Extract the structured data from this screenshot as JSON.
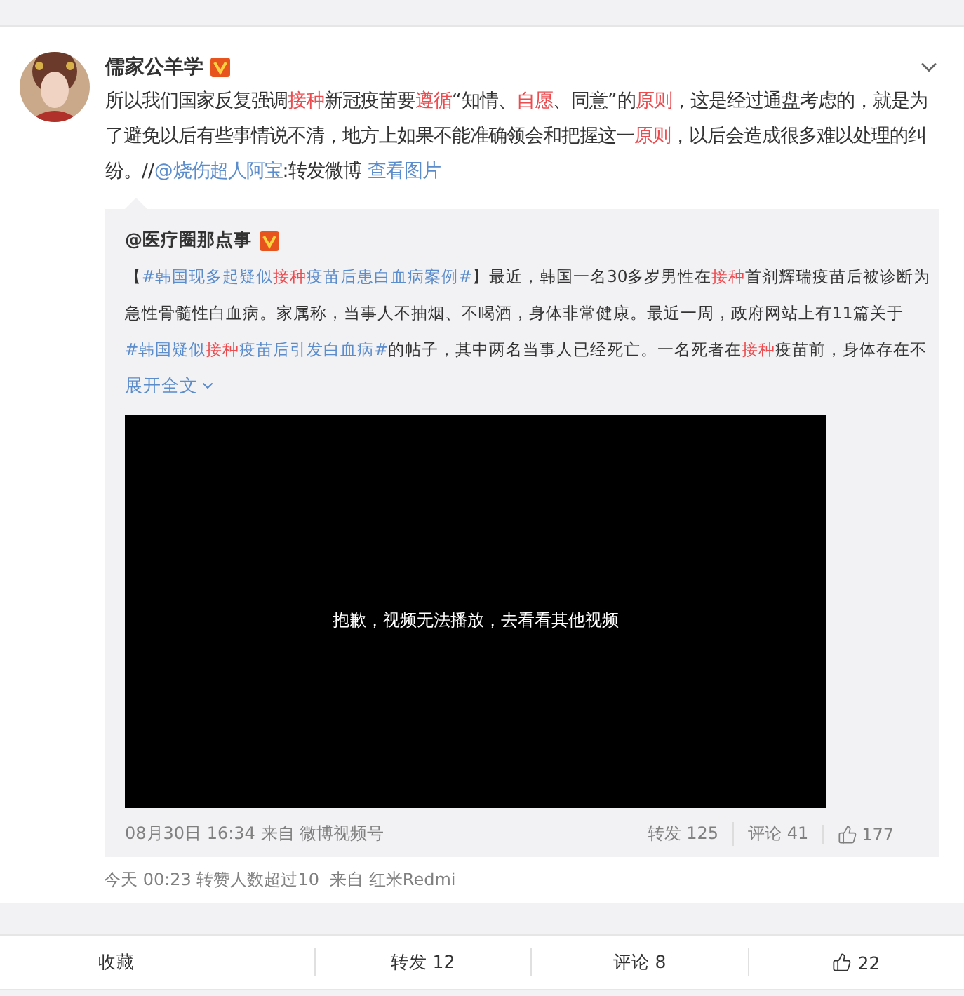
{
  "post": {
    "author": "儒家公羊学",
    "verified": true,
    "text": [
      {
        "kind": "plain",
        "text": "所以我们国家反复强调"
      },
      {
        "kind": "keyword",
        "text": "接种"
      },
      {
        "kind": "plain",
        "text": "新冠疫苗要"
      },
      {
        "kind": "keyword",
        "text": "遵循"
      },
      {
        "kind": "plain",
        "text": "“知情、"
      },
      {
        "kind": "keyword",
        "text": "自愿"
      },
      {
        "kind": "plain",
        "text": "、同意”的"
      },
      {
        "kind": "keyword",
        "text": "原则"
      },
      {
        "kind": "plain",
        "text": "，这是经过通盘考虑的，就是为了避免以后有些事情说不清，地方上如果不能准确领会和把握这一"
      },
      {
        "kind": "keyword",
        "text": "原则"
      },
      {
        "kind": "plain",
        "text": "，以后会造成很多难以处理的纠纷。//"
      },
      {
        "kind": "link",
        "text": "@烧伤超人阿宝"
      },
      {
        "kind": "plain",
        "text": ":转发微博 "
      },
      {
        "kind": "link",
        "text": "查看图片"
      }
    ],
    "repost": {
      "author": "@医疗圈那点事",
      "verified": true,
      "text": [
        {
          "kind": "plain",
          "text": "【"
        },
        {
          "kind": "link",
          "text": "#韩国现多起疑似"
        },
        {
          "kind": "keyword",
          "text": "接种"
        },
        {
          "kind": "link",
          "text": "疫苗后患白血病案例#"
        },
        {
          "kind": "plain",
          "text": "】最近，韩国一名30多岁男性在"
        },
        {
          "kind": "keyword",
          "text": "接种"
        },
        {
          "kind": "plain",
          "text": "首剂辉瑞疫苗后被诊断为急性骨髓性白血病。家属称，当事人不抽烟、不喝酒，身体非常健康。最近一周，政府网站上有11篇关于"
        },
        {
          "kind": "link",
          "text": "#韩国疑似"
        },
        {
          "kind": "keyword",
          "text": "接种"
        },
        {
          "kind": "link",
          "text": "疫苗后引发白血病#"
        },
        {
          "kind": "plain",
          "text": "的帖子，其中两名当事人已经死亡。一名死者在"
        },
        {
          "kind": "keyword",
          "text": "接种"
        },
        {
          "kind": "plain",
          "text": "疫苗前，身体存在不"
        }
      ],
      "expand": "展开全文",
      "video_message": "抱歉，视频无法播放，去看看其他视频",
      "meta": "08月30日 16:34 来自 微博视频号",
      "stats": [
        {
          "kind": "text",
          "label": "转发 125"
        },
        {
          "kind": "text",
          "label": "评论 41"
        },
        {
          "kind": "like",
          "label": "177"
        }
      ]
    },
    "meta": "今天 00:23 转赞人数超过10  来自 红米Redmi"
  },
  "actions": [
    {
      "kind": "text",
      "label": "收藏"
    },
    {
      "kind": "text",
      "label": "转发 12"
    },
    {
      "kind": "text",
      "label": "评论 8"
    },
    {
      "kind": "like",
      "label": "22"
    }
  ]
}
